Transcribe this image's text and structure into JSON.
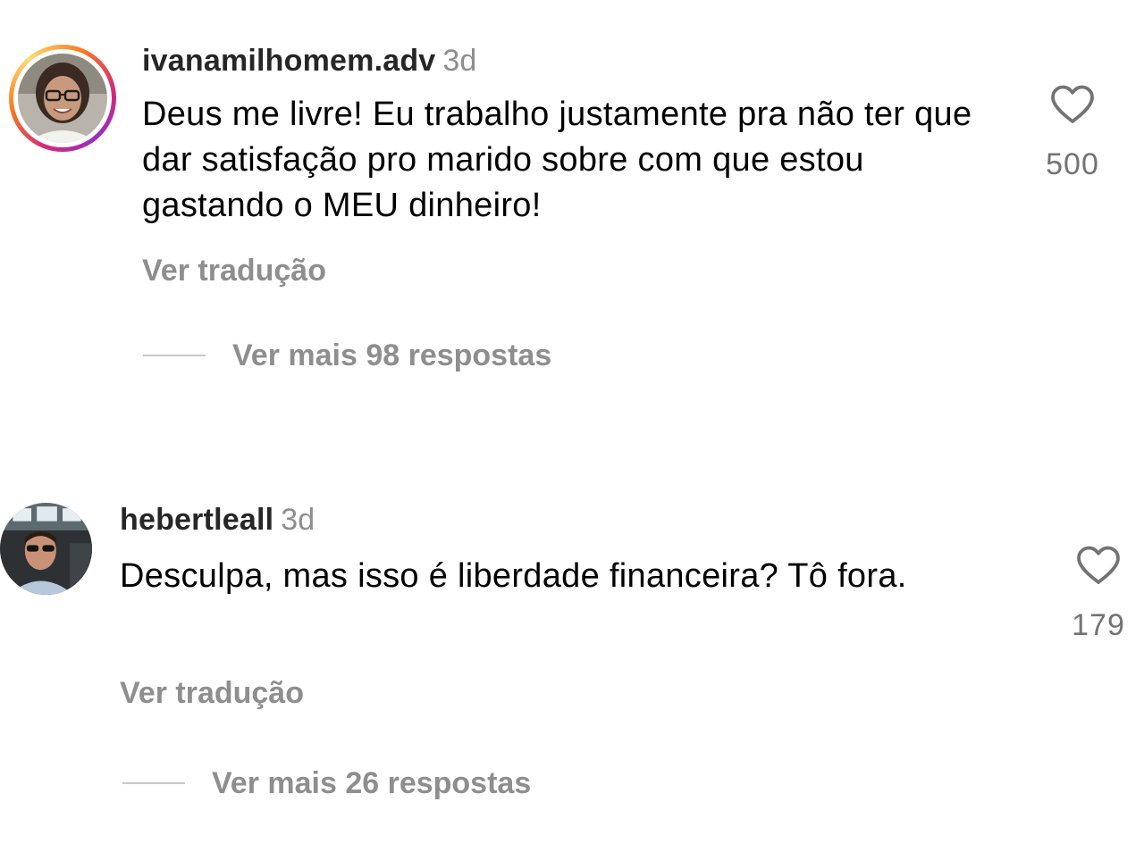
{
  "comments": [
    {
      "username": "ivanamilhomem.adv",
      "time": "3d",
      "text": "Deus me livre! Eu trabalho justamente pra não ter que dar satisfação pro marido sobre com que estou gastando o MEU dinheiro!",
      "translate_label": "Ver tradução",
      "replies_label": "Ver mais 98 respostas",
      "likes": "500",
      "has_story_ring": true
    },
    {
      "username": "hebertleall",
      "time": "3d",
      "text": "Desculpa, mas isso é liberdade financeira? Tô fora.",
      "translate_label": "Ver tradução",
      "replies_label": "Ver mais 26 respostas",
      "likes": "179",
      "has_story_ring": false
    }
  ],
  "icons": {
    "like": "heart-outline-icon"
  },
  "colors": {
    "secondary_text": "#8e8e8e",
    "reply_line": "#c7c7c7",
    "story_ring": [
      "#d62976",
      "#fa7e1e",
      "#feda75",
      "#962fbf"
    ]
  }
}
